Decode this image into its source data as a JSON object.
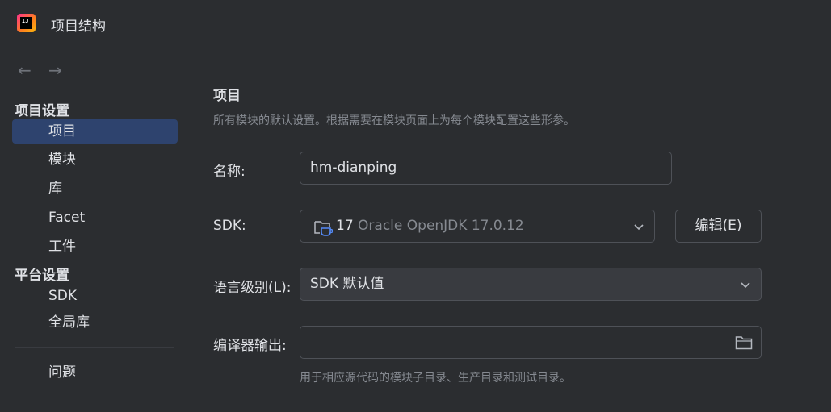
{
  "window": {
    "title": "项目结构"
  },
  "nav": {
    "back": "←",
    "forward": "→"
  },
  "sidebar": {
    "project_settings_header": "项目设置",
    "project_items": [
      "项目",
      "模块",
      "库",
      "Facet",
      "工件"
    ],
    "platform_settings_header": "平台设置",
    "platform_items": [
      "SDK",
      "全局库"
    ],
    "problems_item": "问题",
    "selected": "项目"
  },
  "main": {
    "title": "项目",
    "description": "所有模块的默认设置。根据需要在模块页面上为每个模块配置这些形参。",
    "name_label": "名称:",
    "name_value": "hm-dianping",
    "sdk_label": "SDK:",
    "sdk_version": "17",
    "sdk_name": "Oracle OpenJDK 17.0.12",
    "edit_button": "编辑(E)",
    "language_level_label_prefix": "语言级别(",
    "language_level_label_mnemonic": "L",
    "language_level_label_suffix": "):",
    "language_level_value": "SDK 默认值",
    "compiler_output_label": "编译器输出:",
    "compiler_output_value": "",
    "compiler_output_hint": "用于相应源代码的模块子目录、生产目录和测试目录。"
  },
  "colors": {
    "background": "#2b2d30",
    "selection": "#2e436e",
    "text": "#dfe1e5",
    "muted_text": "#868a91",
    "border": "#4e5157",
    "java_icon_blue": "#548af7"
  },
  "icons": [
    "intellij-logo-icon",
    "arrow-left-icon",
    "arrow-right-icon",
    "folder-java-icon",
    "chevron-down-icon",
    "folder-icon"
  ]
}
